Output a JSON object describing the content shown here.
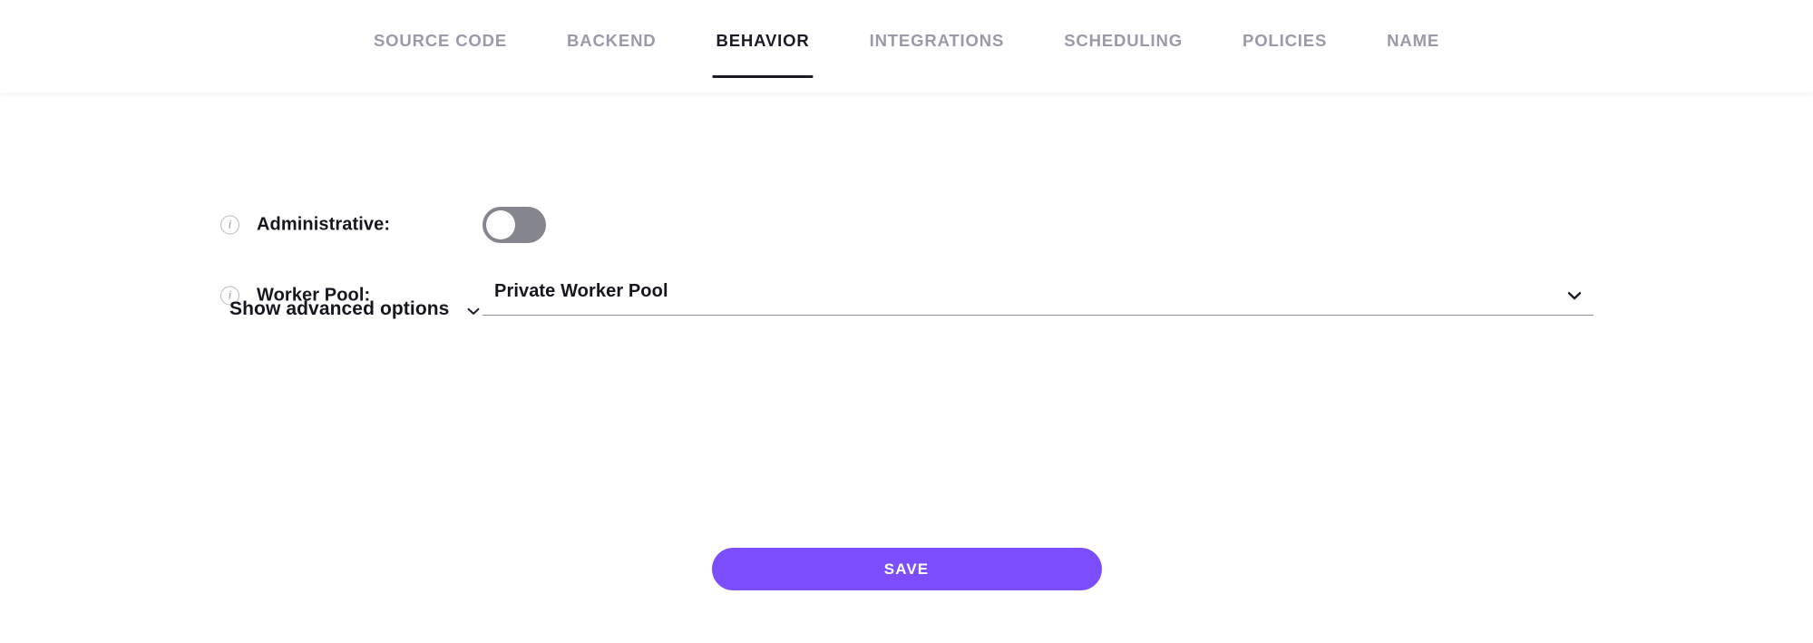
{
  "tabs": {
    "items": [
      {
        "label": "SOURCE CODE",
        "active": false
      },
      {
        "label": "BACKEND",
        "active": false
      },
      {
        "label": "BEHAVIOR",
        "active": true
      },
      {
        "label": "INTEGRATIONS",
        "active": false
      },
      {
        "label": "SCHEDULING",
        "active": false
      },
      {
        "label": "POLICIES",
        "active": false
      },
      {
        "label": "NAME",
        "active": false
      }
    ]
  },
  "form": {
    "administrative": {
      "label": "Administrative:",
      "info_icon": "info-icon",
      "toggle_state": "off"
    },
    "worker_pool": {
      "label": "Worker Pool:",
      "info_icon": "info-icon",
      "value": "Private Worker Pool",
      "chevron_icon": "chevron-down-icon"
    },
    "advanced": {
      "label": "Show advanced options",
      "chevron_icon": "chevron-down-icon"
    }
  },
  "actions": {
    "save_label": "SAVE"
  },
  "colors": {
    "accent": "#7c4dfd",
    "tab_active": "#1b1b26",
    "tab_inactive": "#9a9aa8",
    "toggle_off_track": "#85858f",
    "text": "#16161f",
    "underline": "#8d8d99"
  }
}
